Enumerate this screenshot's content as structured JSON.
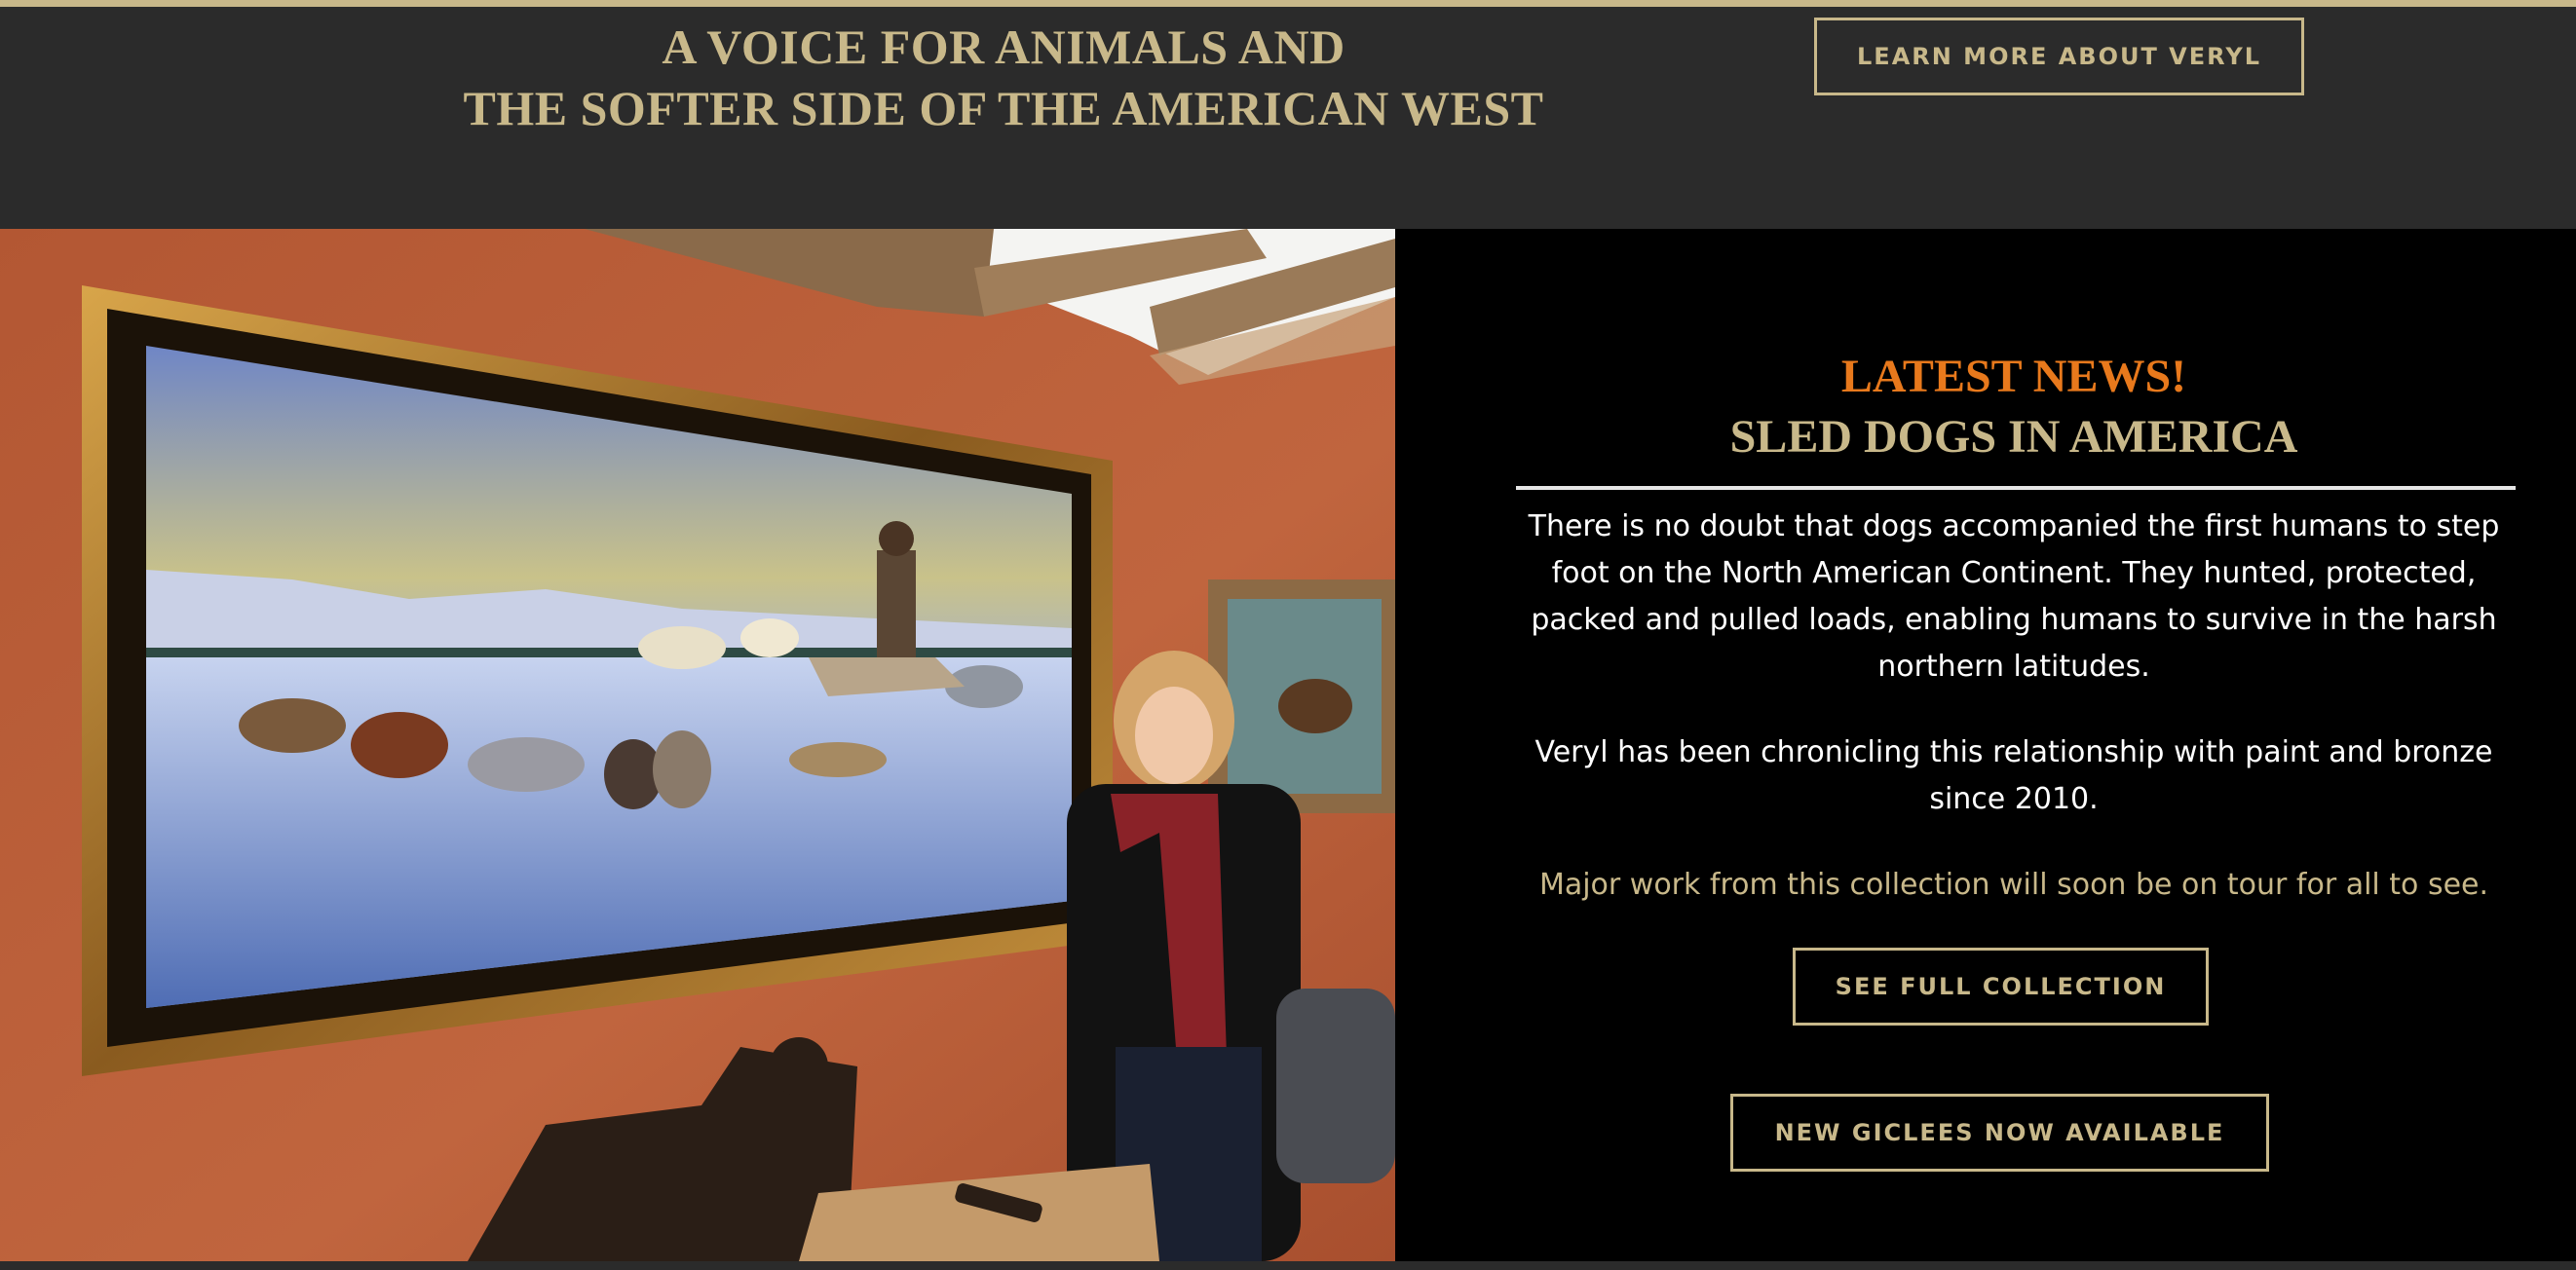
{
  "header": {
    "tagline_line1": "A VOICE FOR ANIMALS AND",
    "tagline_line2": "THE SOFTER SIDE OF THE AMERICAN WEST",
    "learn_more_label": "LEARN MORE ABOUT VERYL"
  },
  "news": {
    "kicker": "LATEST NEWS!",
    "title": "SLED DOGS IN AMERICA",
    "paragraph1": "There is no doubt that dogs accompanied the first humans to step foot on the North American Continent. They hunted, protected, packed and pulled loads, enabling humans to survive in the harsh northern latitudes.",
    "paragraph2": "Veryl has been chronicling this relationship with paint and bronze since 2010.",
    "paragraph3": "Major work from this collection will soon be on tour for all to see.",
    "collection_button": "SEE FULL COLLECTION",
    "giclees_button": "NEW GICLEES NOW AVAILABLE"
  },
  "colors": {
    "gold": "#c8b88a",
    "orange": "#e8791c",
    "header_bg": "#2b2b2b",
    "panel_bg": "#000000"
  }
}
